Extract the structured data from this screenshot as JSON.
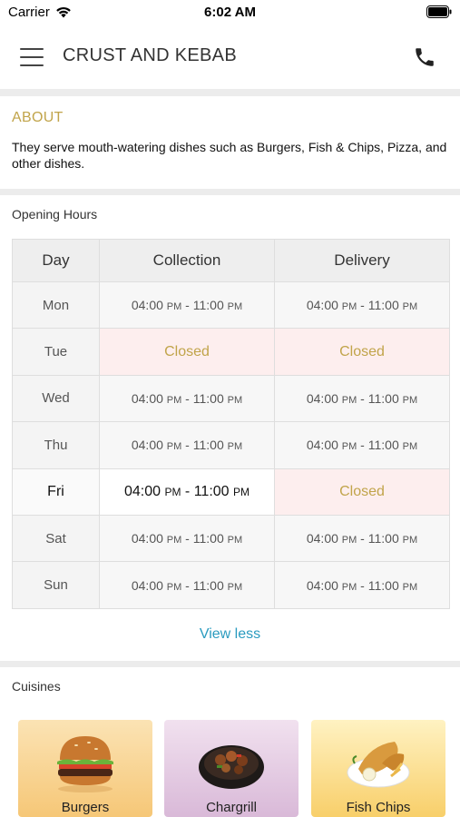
{
  "status_bar": {
    "carrier": "Carrier",
    "time": "6:02 AM"
  },
  "navbar": {
    "title": "CRUST AND KEBAB",
    "menu_icon": "hamburger-menu-icon",
    "phone_icon": "phone-icon"
  },
  "about": {
    "heading": "ABOUT",
    "text": "They serve mouth-watering dishes such as Burgers, Fish & Chips, Pizza,  and other dishes."
  },
  "opening_hours": {
    "heading": "Opening Hours",
    "columns": [
      "Day",
      "Collection",
      "Delivery"
    ],
    "rows": [
      {
        "day": "Mon",
        "collection": [
          "04:00",
          "PM",
          " - 11:00",
          "PM"
        ],
        "delivery": [
          "04:00",
          "PM",
          " - 11:00",
          "PM"
        ]
      },
      {
        "day": "Tue",
        "collection_closed": "Closed",
        "delivery_closed": "Closed"
      },
      {
        "day": "Wed",
        "collection": [
          "04:00",
          "PM",
          " - 11:00",
          "PM"
        ],
        "delivery": [
          "04:00",
          "PM",
          " - 11:00",
          "PM"
        ]
      },
      {
        "day": "Thu",
        "collection": [
          "04:00",
          "PM",
          " - 11:00",
          "PM"
        ],
        "delivery": [
          "04:00",
          "PM",
          " - 11:00",
          "PM"
        ]
      },
      {
        "day": "Fri",
        "collection": [
          "04:00",
          "PM",
          " - 11:00",
          "PM"
        ],
        "delivery_closed": "Closed"
      },
      {
        "day": "Sat",
        "collection": [
          "04:00",
          "PM",
          " - 11:00",
          "PM"
        ],
        "delivery": [
          "04:00",
          "PM",
          " - 11:00",
          "PM"
        ]
      },
      {
        "day": "Sun",
        "collection": [
          "04:00",
          "PM",
          " - 11:00",
          "PM"
        ],
        "delivery": [
          "04:00",
          "PM",
          " - 11:00",
          "PM"
        ]
      }
    ],
    "view_less": "View less"
  },
  "cuisines": {
    "heading": "Cuisines",
    "items": [
      {
        "label": "Burgers"
      },
      {
        "label": "Chargrill"
      },
      {
        "label": "Fish  Chips"
      }
    ]
  },
  "colors": {
    "accent_gold": "#c1a44a",
    "link_blue": "#2a9bbf",
    "closed_bg": "#fdeeee"
  }
}
